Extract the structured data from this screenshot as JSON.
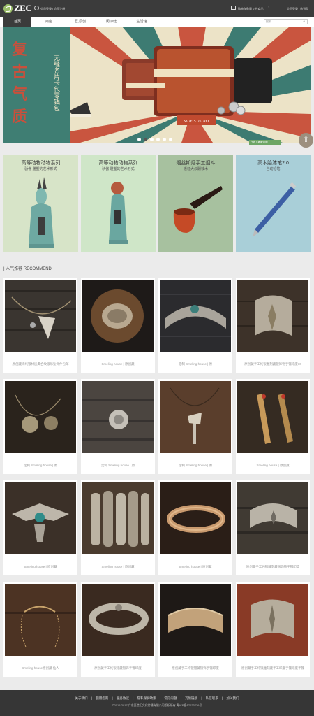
{
  "header": {
    "logo": "ZEC",
    "login_links": "会员登录 | 会员注册",
    "cart_text": "购物车数量 0 件商品",
    "right_links": "会员登录 | 收到货"
  },
  "menu": {
    "items": [
      {
        "label": "首页",
        "active": true
      },
      {
        "label": "商店",
        "active": false
      },
      {
        "label": "匠,原创",
        "active": false
      },
      {
        "label": "闲,杂志",
        "active": false
      },
      {
        "label": "生活馆",
        "active": false
      }
    ],
    "search_placeholder": "搜索"
  },
  "banner": {
    "big_text": [
      "复",
      "古",
      "气",
      "质"
    ],
    "sub_text": "无缝名片卡包零钱包",
    "brand_tag": "SIDE STUDIO",
    "dots": 6,
    "active_dot": 1,
    "mini_bar_text": "在线上客服咨询"
  },
  "categories": [
    {
      "title": "高等动物动物系列",
      "subtitle": "骄傲 雕塑的艺术形式",
      "bg": "#d7e4c8",
      "figure": "antelope"
    },
    {
      "title": "高等动物动物系列",
      "subtitle": "骄傲 雕塑的艺术形式",
      "bg": "#cfe6c8",
      "figure": "bird"
    },
    {
      "title": "烟丝斯烟手工烟斗",
      "subtitle": "老虹大叔酬枝木",
      "bg": "#a7c19f",
      "figure": "pipe"
    },
    {
      "title": "高木胎漆笔2.0",
      "subtitle": "自动铅笔",
      "bg": "#a9cfd8",
      "figure": "pen"
    }
  ],
  "recommend": {
    "title": "| 人气推荐 RECOMMEND",
    "items": [
      {
        "caption": "原创藏饰纯银材质鹰合纹银吊坠饰件包邮",
        "kind": "arrowhead"
      },
      {
        "caption": "Smeling house | 原创藏",
        "kind": "eagle_ring"
      },
      {
        "caption": "定制 Smeling house | 原",
        "kind": "cuff_turq"
      },
      {
        "caption": "原创藏手工纯银雕刻藏银饰物手镯印度10",
        "kind": "cuff_feather"
      },
      {
        "caption": "定制 Smeling house | 原",
        "kind": "necklace_sun"
      },
      {
        "caption": "定制 Smeling house | 原",
        "kind": "pendant_wood"
      },
      {
        "caption": "定制 Smeling house | 原",
        "kind": "axe"
      },
      {
        "caption": "Smeling house | 原创藏",
        "kind": "feathers"
      },
      {
        "caption": "Smeling house | 原创藏",
        "kind": "thunderbird"
      },
      {
        "caption": "Smeling house | 原创藏",
        "kind": "rings_stack"
      },
      {
        "caption": "Smeling house | 原创藏",
        "kind": "bracelet_thin"
      },
      {
        "caption": "原创藏手工纯银雕刻藏银饰物手镯印度",
        "kind": "cuff_star"
      },
      {
        "caption": "Smeling house原创藏 仙人",
        "kind": "hook_chain"
      },
      {
        "caption": "原创藏手工纯银错藏银饰手镯印度",
        "kind": "ring_stamp"
      },
      {
        "caption": "原创藏手工纯银错藏银饰手镯印度",
        "kind": "cuff_wide"
      },
      {
        "caption": "原创藏手工纯银雕刻藏手工印度手镯印度手镯",
        "kind": "cuff_feather2"
      }
    ]
  },
  "footer": {
    "links": [
      "关于我们",
      "|",
      "使用指南",
      "|",
      "服务协议",
      "|",
      "隐私保护政策",
      "|",
      "常见问题",
      "|",
      "友情链接",
      "|",
      "私信联系",
      "|",
      "加入我们"
    ],
    "copyright": "©2015-2017 广东匠造汇文化传播有限公司版权所有 粤ICP备17023726号"
  }
}
